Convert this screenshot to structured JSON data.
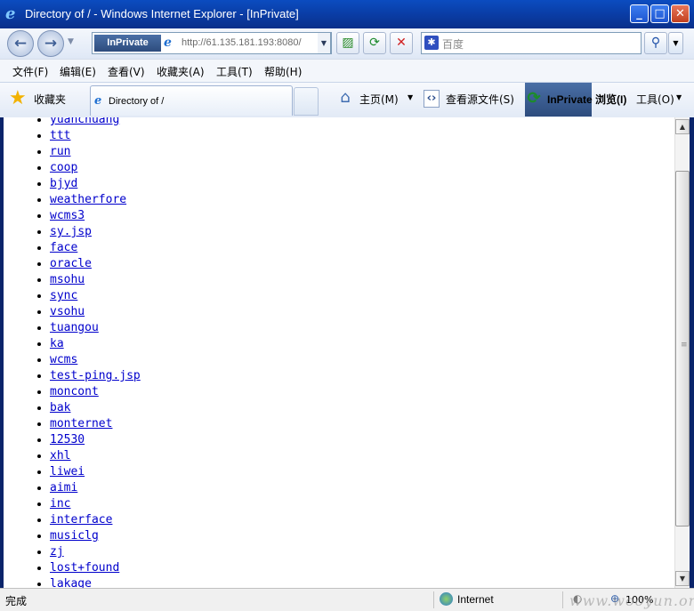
{
  "window": {
    "title": "Directory of / - Windows Internet Explorer - [InPrivate]",
    "minimize": "_",
    "maximize": "□",
    "close": "✕"
  },
  "address_bar": {
    "inprivate_badge": "InPrivate",
    "url": "http://61.135.181.193:8080/",
    "search_placeholder": "百度",
    "search_logo_icon": "baidu-paw-icon"
  },
  "menu": {
    "items": [
      "文件(F)",
      "编辑(E)",
      "查看(V)",
      "收藏夹(A)",
      "工具(T)",
      "帮助(H)"
    ]
  },
  "command_bar": {
    "favorites_label": "收藏夹",
    "tab_label": "Directory of /",
    "home_label": "主页(M)",
    "view_source_label": "查看源文件(S)",
    "inprivate_browse_label": "InPrivate 浏览(I)",
    "tools_label": "工具(O)"
  },
  "listing": {
    "entries": [
      "yuanchuang",
      "ttt",
      "run",
      "coop",
      "bjyd",
      "weatherfore",
      "wcms3",
      "sy.jsp",
      "face",
      "oracle",
      "msohu",
      "sync",
      "vsohu",
      "tuangou",
      "ka",
      "wcms",
      "test-ping.jsp",
      "moncont",
      "bak",
      "monternet",
      "12530",
      "xhl",
      "liwei",
      "aimi",
      "inc",
      "interface",
      "musiclg",
      "zj",
      "lost+found",
      "lakage"
    ]
  },
  "status_bar": {
    "status": "完成",
    "zone": "Internet",
    "zoom": "100%"
  },
  "watermark": "www.wooyun.org"
}
